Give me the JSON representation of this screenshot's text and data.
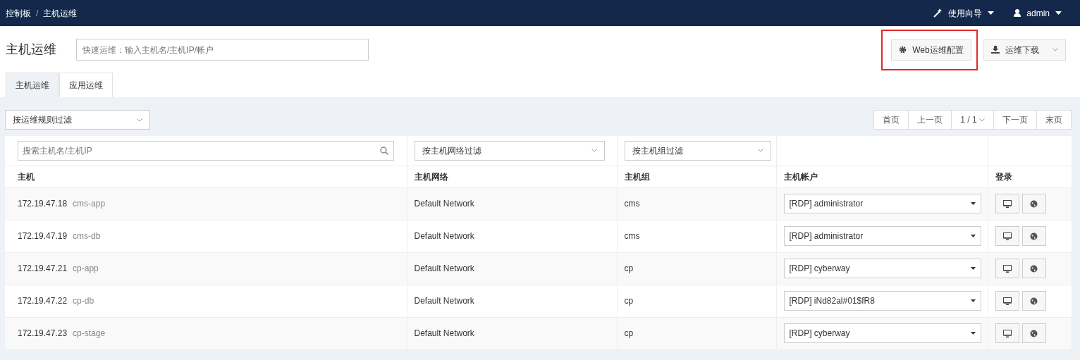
{
  "breadcrumb": [
    "控制板",
    "主机运维"
  ],
  "breadcrumb_separator": "/",
  "navbar": {
    "guide": "使用向导",
    "user": "admin"
  },
  "page_title": "主机运维",
  "quick_search": {
    "placeholder": "快速运维：输入主机名/主机IP/帐户"
  },
  "actions": [
    {
      "kind": "config",
      "label": "Web运维配置",
      "highlighted": true
    },
    {
      "kind": "download",
      "label": "运维下载",
      "highlighted": false
    }
  ],
  "tabs": [
    {
      "label": "主机运维",
      "selected": true
    },
    {
      "label": "应用运维",
      "selected": false
    }
  ],
  "rule_filter": "按运维规则过滤",
  "pager": {
    "first": "首页",
    "prev": "上一页",
    "page": "1 / 1",
    "next": "下一页",
    "last": "末页"
  },
  "table": {
    "host_search": {
      "placeholder": "搜索主机名/主机IP"
    },
    "network_filter": "按主机网络过滤",
    "group_filter": "按主机组过滤",
    "columns": [
      "主机",
      "主机网络",
      "主机组",
      "主机帐户",
      "登录"
    ],
    "rows": [
      {
        "ip": "172.19.47.18",
        "name": "cms-app",
        "network": "Default Network",
        "group": "cms",
        "account": "[RDP] administrator"
      },
      {
        "ip": "172.19.47.19",
        "name": "cms-db",
        "network": "Default Network",
        "group": "cms",
        "account": "[RDP] administrator"
      },
      {
        "ip": "172.19.47.21",
        "name": "cp-app",
        "network": "Default Network",
        "group": "cp",
        "account": "[RDP] cyberway"
      },
      {
        "ip": "172.19.47.22",
        "name": "cp-db",
        "network": "Default Network",
        "group": "cp",
        "account": "[RDP] iNd82al#01$fR8"
      },
      {
        "ip": "172.19.47.23",
        "name": "cp-stage",
        "network": "Default Network",
        "group": "cp",
        "account": "[RDP] cyberway"
      }
    ]
  }
}
